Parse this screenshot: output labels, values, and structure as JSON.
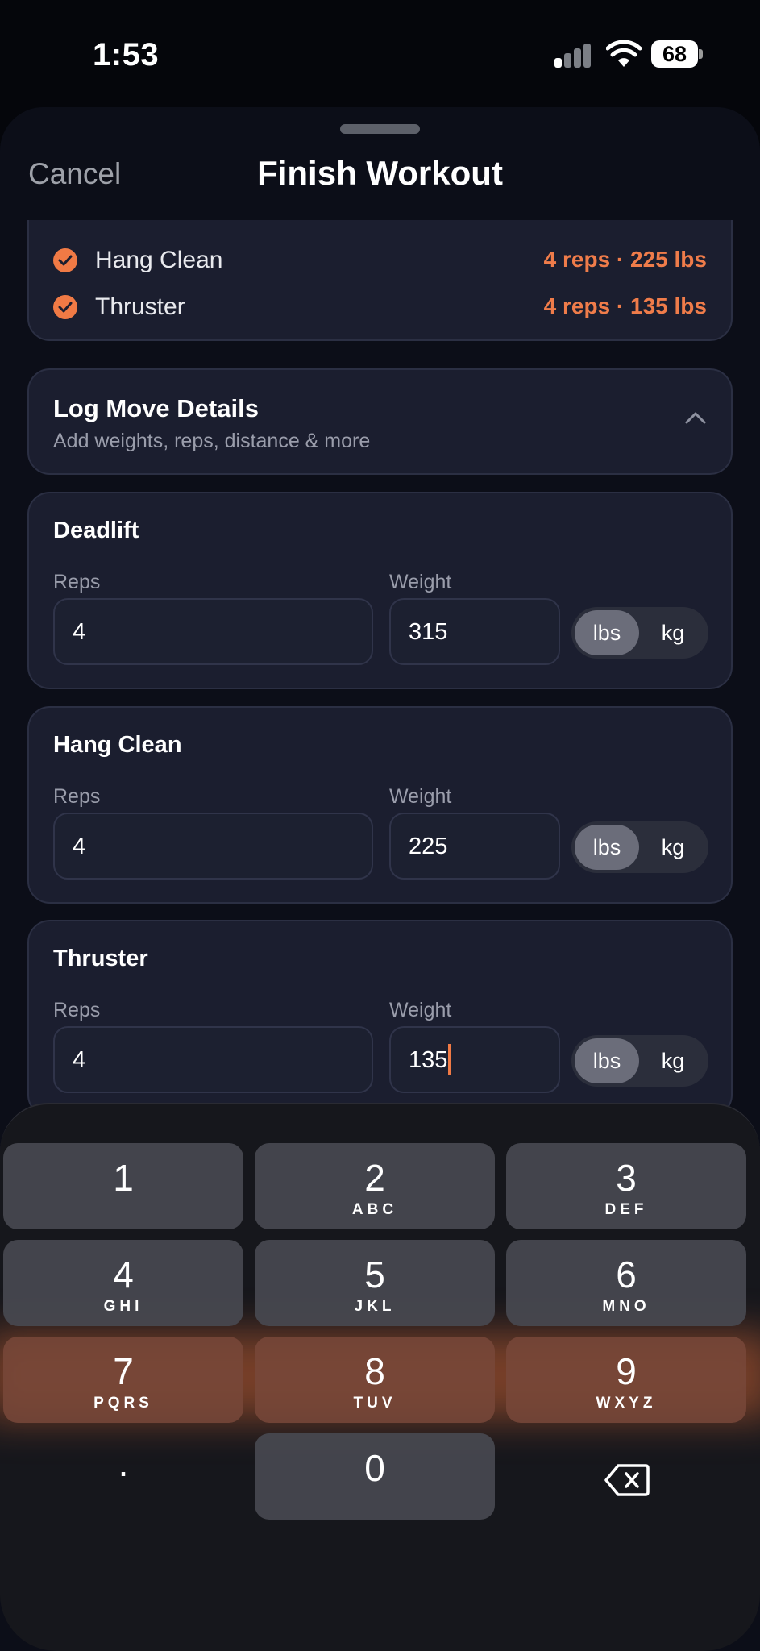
{
  "status": {
    "time": "1:53",
    "battery": "68"
  },
  "header": {
    "cancel": "Cancel",
    "title": "Finish Workout"
  },
  "summary": {
    "items": [
      {
        "name": "Hang Clean",
        "detail": "4 reps · 225 lbs"
      },
      {
        "name": "Thruster",
        "detail": "4 reps · 135 lbs"
      }
    ]
  },
  "log": {
    "title": "Log Move Details",
    "subtitle": "Add weights, reps, distance & more"
  },
  "moves": [
    {
      "name": "Deadlift",
      "reps_label": "Reps",
      "weight_label": "Weight",
      "reps": "4",
      "weight": "315",
      "unit_lbs": "lbs",
      "unit_kg": "kg"
    },
    {
      "name": "Hang Clean",
      "reps_label": "Reps",
      "weight_label": "Weight",
      "reps": "4",
      "weight": "225",
      "unit_lbs": "lbs",
      "unit_kg": "kg"
    },
    {
      "name": "Thruster",
      "reps_label": "Reps",
      "weight_label": "Weight",
      "reps": "4",
      "weight": "135",
      "unit_lbs": "lbs",
      "unit_kg": "kg"
    }
  ],
  "keyboard": {
    "keys": [
      {
        "num": "1",
        "letters": ""
      },
      {
        "num": "2",
        "letters": "ABC"
      },
      {
        "num": "3",
        "letters": "DEF"
      },
      {
        "num": "4",
        "letters": "GHI"
      },
      {
        "num": "5",
        "letters": "JKL"
      },
      {
        "num": "6",
        "letters": "MNO"
      },
      {
        "num": "7",
        "letters": "PQRS"
      },
      {
        "num": "8",
        "letters": "TUV"
      },
      {
        "num": "9",
        "letters": "WXYZ"
      },
      {
        "num": ".",
        "letters": ""
      },
      {
        "num": "0",
        "letters": ""
      }
    ]
  },
  "colors": {
    "accent": "#f07a45",
    "card": "#1b1e2f",
    "background": "#0c0e18"
  },
  "icons": {
    "check": "check-icon",
    "chevron": "chevron-up-icon",
    "backspace": "backspace-icon"
  }
}
